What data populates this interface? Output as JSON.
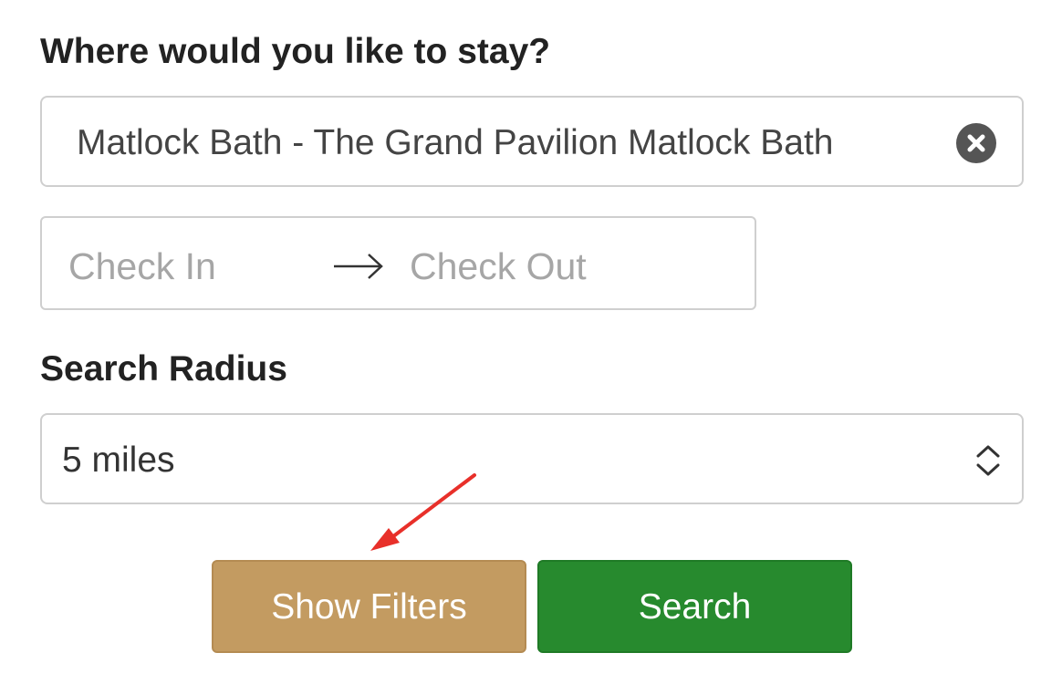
{
  "location": {
    "heading": "Where would you like to stay?",
    "value": "Matlock Bath - The Grand Pavilion Matlock Bath",
    "clear_icon": "close-circle-icon"
  },
  "dates": {
    "check_in_placeholder": "Check In",
    "check_out_placeholder": "Check Out",
    "arrow_icon": "arrow-right-icon"
  },
  "radius": {
    "heading": "Search Radius",
    "selected": "5 miles",
    "select_icon": "chevron-up-down-icon"
  },
  "actions": {
    "show_filters_label": "Show Filters",
    "search_label": "Search"
  },
  "annotation": {
    "icon": "red-arrow-pointer"
  },
  "colors": {
    "show_filters_bg": "#c39b61",
    "search_bg": "#278a2e",
    "annotation": "#e8302a",
    "clear_icon_bg": "#555555"
  }
}
